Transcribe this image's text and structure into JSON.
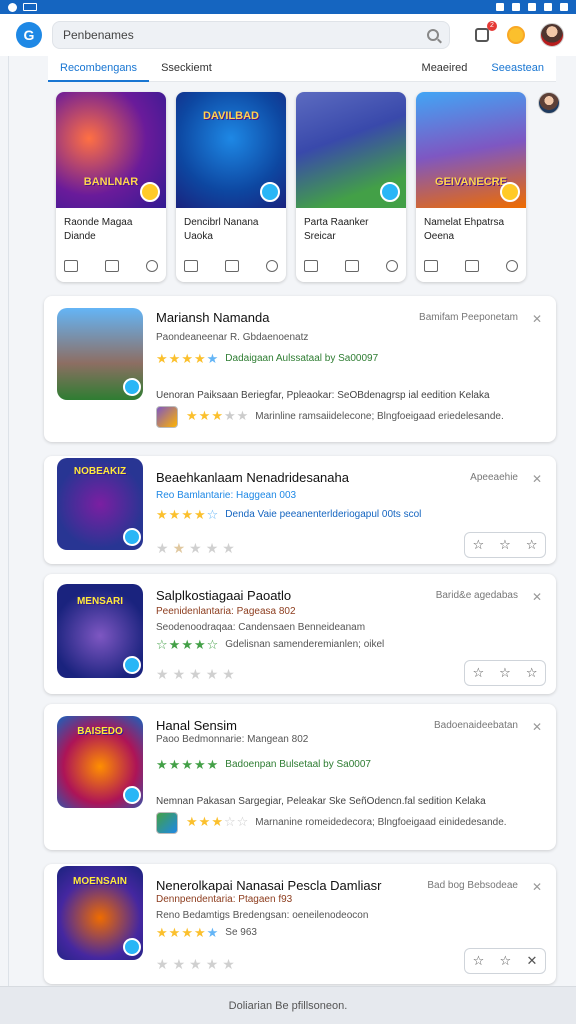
{
  "header": {
    "search_value": "Penbenames",
    "logo_letter": "G",
    "notif_count": "2"
  },
  "tabs": [
    "Recombengans",
    "Sseckiemt",
    "Meaeired",
    "Seeastean"
  ],
  "featured": [
    {
      "art_title": "BANLNAR",
      "name_line1": "Raonde Magaa",
      "name_line2": "Diande",
      "badge": "yellow"
    },
    {
      "art_title": "DAVILBAD",
      "name_line1": "Dencibrl Nanana",
      "name_line2": "Uaoka",
      "badge": "blue"
    },
    {
      "art_title": "",
      "name_line1": "Parta Raanker",
      "name_line2": "Sreicar",
      "badge": "blue"
    },
    {
      "art_title": "GEIVANECRE",
      "name_line1": "Namelat Ehpatrsa",
      "name_line2": "Oeena",
      "badge": "yellow"
    }
  ],
  "apps": [
    {
      "title": "Mariansh Namanda",
      "meta": "Bamifam Peeponetam",
      "sub": "Paondeaneenar R. Gbdaenoenatz",
      "rating_text": "Dadaigaan Aulssataal by Sa00097",
      "stars": "green-text",
      "desc": "Uenoran Paiksaan Beriegfar, Ppleaokar: SeOBdenagrsp ial eedition Kelaka",
      "mini_text": "Marinline ramsaiidelecone; Blngfoeigaad eriedelesande.",
      "icon_title": ""
    },
    {
      "title": "Beaehkanlaam Nenadridesanaha",
      "meta": "Apeeaehie",
      "sub": "Reo Bamlantarie: Haggean 003",
      "rating_text": "Denda Vaie peeanenterlderiogapul 00ts scol",
      "desc": "",
      "mini_text": "",
      "icon_title": "NOBEAKIZ"
    },
    {
      "title": "Salplkostiagaai Paoatlo",
      "meta": "Barid&e agedabas",
      "sub": "Peenidenlantaria: Pageasa 802",
      "sub2": "Seodenoodraqaa: Candensaen Benneideanam",
      "rating_text": "Gdelisnan samenderemianlen; oikel",
      "desc": "",
      "mini_text": "",
      "icon_title": "MENSARI"
    },
    {
      "title": "Hanal Sensim",
      "meta": "Badoenaideebatan",
      "sub": "Paoo Bedmonnarie: Mangean 802",
      "rating_text": "Badoenpan Bulsetaal by Sa0007",
      "desc": "Nemnan Pakasan Sargegiar, Peleakar Ske SeñOdencn.fal sedition Kelaka",
      "mini_text": "Marnanine romeidedecora; Blngfoeigaad einidedesande.",
      "icon_title": "BAISEDO"
    },
    {
      "title": "Nenerolkapai Nanasai Pescla Damliasr",
      "meta": "Bad bog Bebsodeae",
      "sub": "Dennpendentaria: Ptagaen f93",
      "sub2": "Reno Bedamtigs Bredengsan: oeneilenodeocon",
      "rating_text": "Se 963",
      "desc": "",
      "mini_text": "",
      "icon_title": "MOENSAIN"
    }
  ],
  "footer": {
    "text": "Doliarian Be pfillsoneon."
  },
  "colors": {
    "accent": "#1976d2",
    "statusbar": "#1565c0",
    "star": "#fbc02d",
    "green": "#43a047"
  }
}
